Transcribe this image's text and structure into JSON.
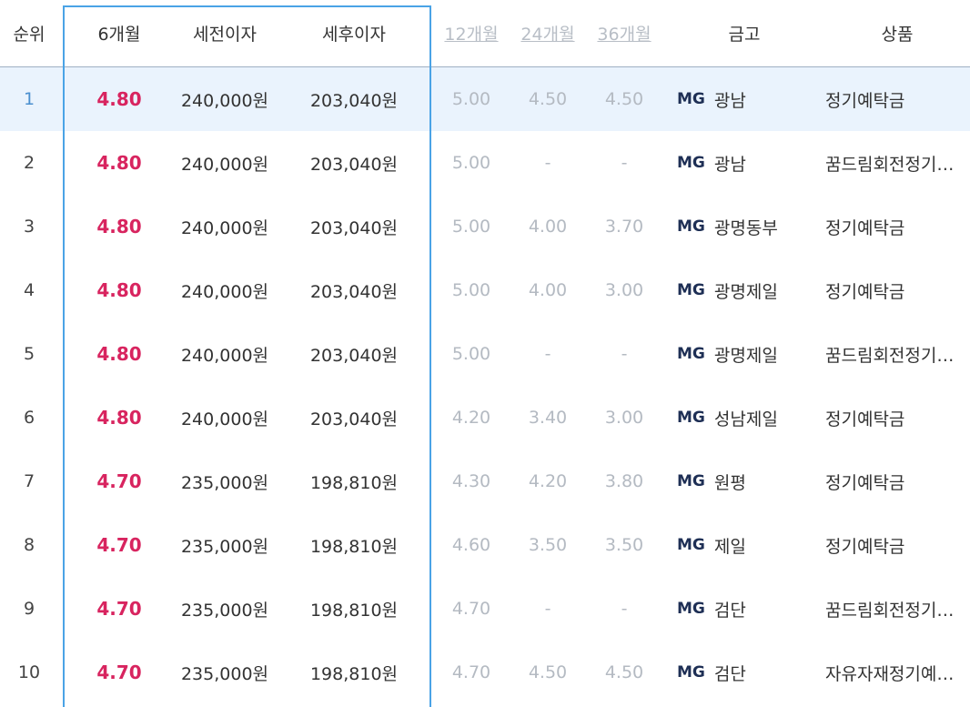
{
  "header": {
    "rank": "순위",
    "m6": "6개월",
    "pre_tax": "세전이자",
    "post_tax": "세후이자",
    "m12": "12개월",
    "m24": "24개월",
    "m36": "36개월",
    "bank": "금고",
    "product": "상품"
  },
  "rows": [
    {
      "rank": "1",
      "m6": "4.80",
      "pre": "240,000원",
      "post": "203,040원",
      "m12": "5.00",
      "m24": "4.50",
      "m36": "4.50",
      "mg": "MG",
      "bank": "광남",
      "product": "정기예탁금"
    },
    {
      "rank": "2",
      "m6": "4.80",
      "pre": "240,000원",
      "post": "203,040원",
      "m12": "5.00",
      "m24": "-",
      "m36": "-",
      "mg": "MG",
      "bank": "광남",
      "product": "꿈드림회전정기…"
    },
    {
      "rank": "3",
      "m6": "4.80",
      "pre": "240,000원",
      "post": "203,040원",
      "m12": "5.00",
      "m24": "4.00",
      "m36": "3.70",
      "mg": "MG",
      "bank": "광명동부",
      "product": "정기예탁금"
    },
    {
      "rank": "4",
      "m6": "4.80",
      "pre": "240,000원",
      "post": "203,040원",
      "m12": "5.00",
      "m24": "4.00",
      "m36": "3.00",
      "mg": "MG",
      "bank": "광명제일",
      "product": "정기예탁금"
    },
    {
      "rank": "5",
      "m6": "4.80",
      "pre": "240,000원",
      "post": "203,040원",
      "m12": "5.00",
      "m24": "-",
      "m36": "-",
      "mg": "MG",
      "bank": "광명제일",
      "product": "꿈드림회전정기…"
    },
    {
      "rank": "6",
      "m6": "4.80",
      "pre": "240,000원",
      "post": "203,040원",
      "m12": "4.20",
      "m24": "3.40",
      "m36": "3.00",
      "mg": "MG",
      "bank": "성남제일",
      "product": "정기예탁금"
    },
    {
      "rank": "7",
      "m6": "4.70",
      "pre": "235,000원",
      "post": "198,810원",
      "m12": "4.30",
      "m24": "4.20",
      "m36": "3.80",
      "mg": "MG",
      "bank": "원평",
      "product": "정기예탁금"
    },
    {
      "rank": "8",
      "m6": "4.70",
      "pre": "235,000원",
      "post": "198,810원",
      "m12": "4.60",
      "m24": "3.50",
      "m36": "3.50",
      "mg": "MG",
      "bank": "제일",
      "product": "정기예탁금"
    },
    {
      "rank": "9",
      "m6": "4.70",
      "pre": "235,000원",
      "post": "198,810원",
      "m12": "4.70",
      "m24": "-",
      "m36": "-",
      "mg": "MG",
      "bank": "검단",
      "product": "꿈드림회전정기…"
    },
    {
      "rank": "10",
      "m6": "4.70",
      "pre": "235,000원",
      "post": "198,810원",
      "m12": "4.70",
      "m24": "4.50",
      "m36": "4.50",
      "mg": "MG",
      "bank": "검단",
      "product": "자유자재정기예…"
    }
  ],
  "colors": {
    "accent_box": "#4aa3e6",
    "rate": "#d8245f",
    "highlight_row": "#eaf3fd"
  }
}
